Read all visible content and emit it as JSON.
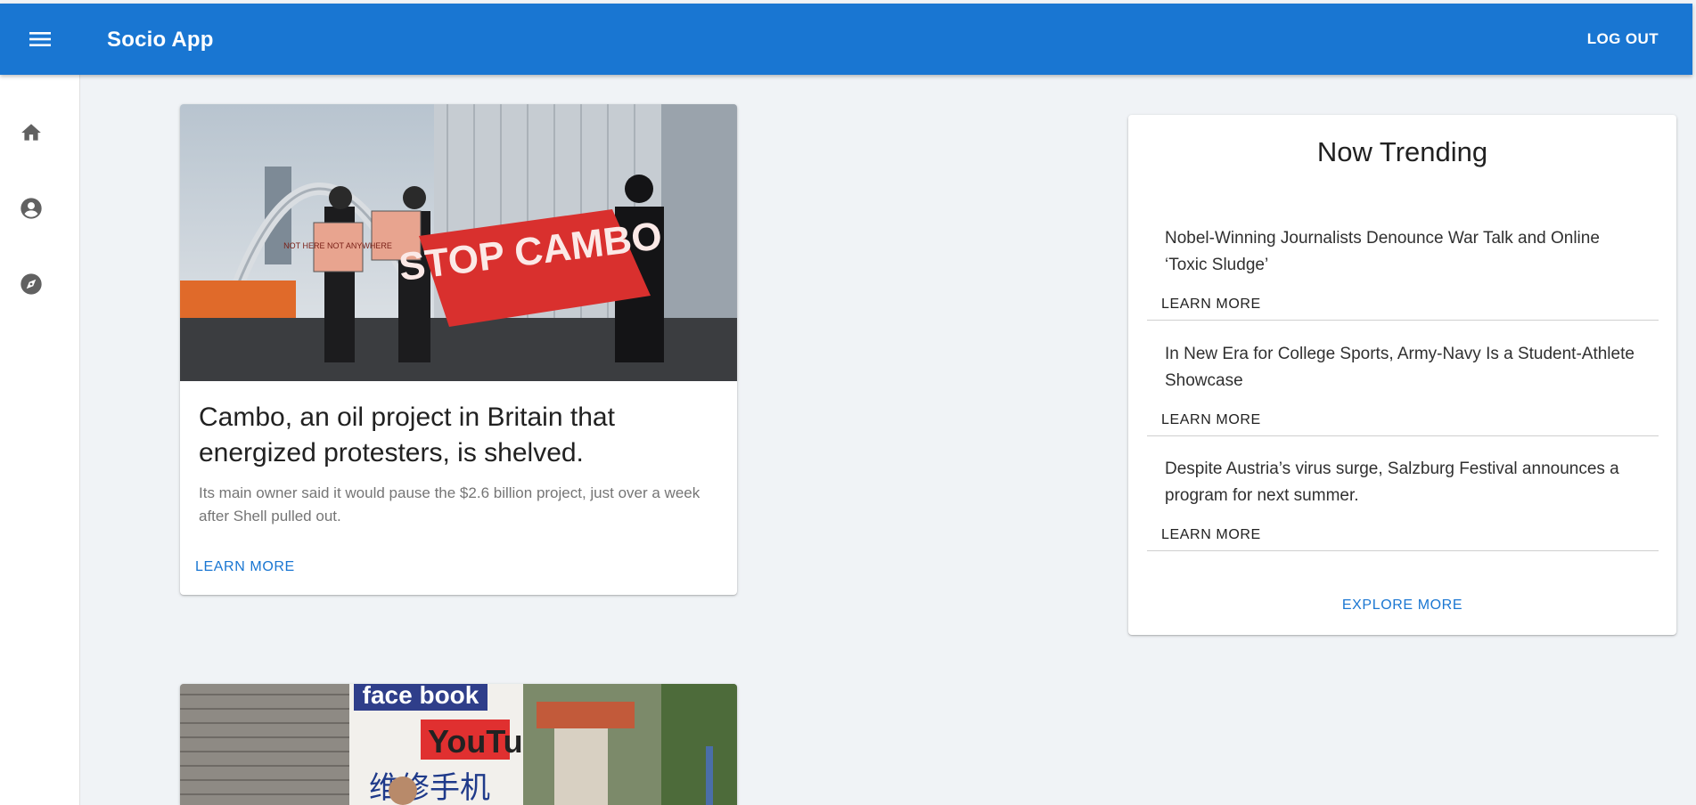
{
  "app": {
    "title": "Socio App",
    "logout_label": "LOG OUT",
    "accent": "#1976d2"
  },
  "sidebar": {
    "items": [
      {
        "icon": "home-icon"
      },
      {
        "icon": "account-circle-icon"
      },
      {
        "icon": "explore-icon"
      }
    ]
  },
  "feed": {
    "cards": [
      {
        "title": "Cambo, an oil project in Britain that energized protesters, is shelved.",
        "description": "Its main owner said it would pause the $2.6 billion project, just over a week after Shell pulled out.",
        "learn_more": "LEARN MORE",
        "sign_text": "STOP CAMBO",
        "placard_text": "NOT HERE NOT ANYWHERE"
      },
      {
        "sign_text_1": "face book",
        "sign_text_2": "YouTube",
        "sign_text_3": "维修手机"
      }
    ]
  },
  "trending": {
    "title": "Now Trending",
    "items": [
      {
        "headline": "Nobel-Winning Journalists Denounce War Talk and Online ‘Toxic Sludge’",
        "learn_more": "LEARN MORE"
      },
      {
        "headline": "In New Era for College Sports, Army-Navy Is a Student-Athlete Showcase",
        "learn_more": "LEARN MORE"
      },
      {
        "headline": "Despite Austria’s virus surge, Salzburg Festival announces a program for next summer.",
        "learn_more": "LEARN MORE"
      }
    ],
    "explore_label": "EXPLORE MORE"
  }
}
